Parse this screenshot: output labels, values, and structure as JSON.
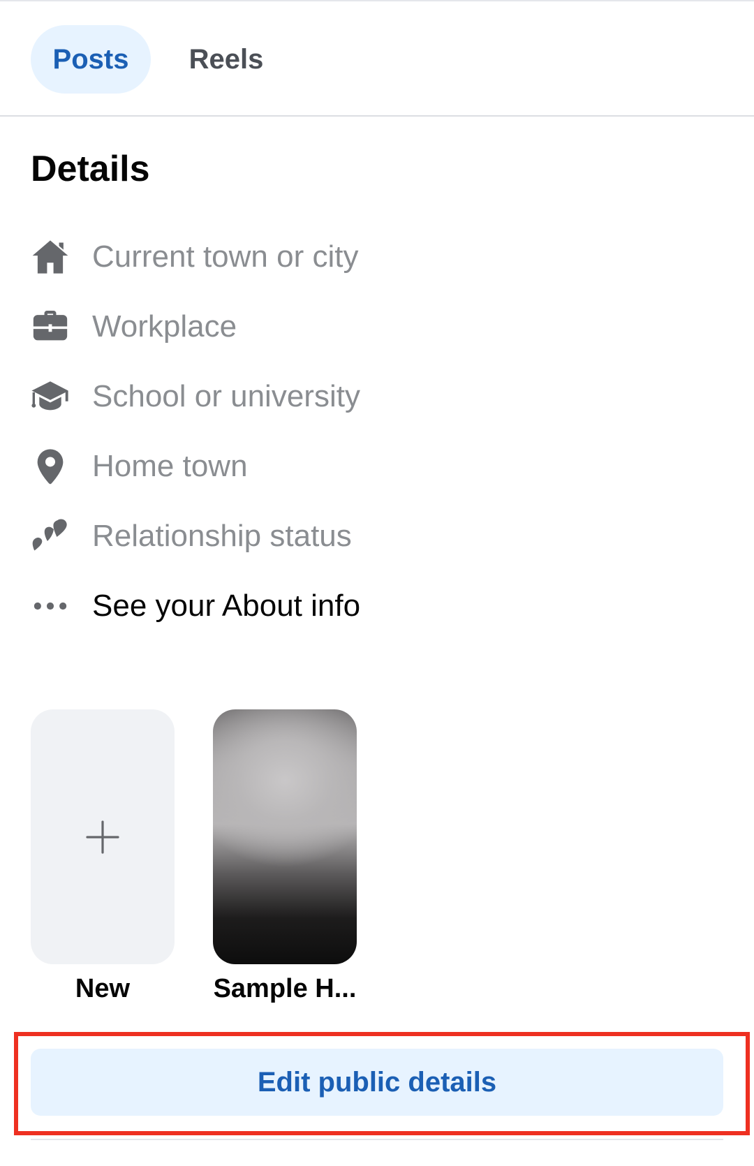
{
  "tabs": [
    {
      "label": "Posts",
      "active": true
    },
    {
      "label": "Reels",
      "active": false
    }
  ],
  "details": {
    "title": "Details",
    "items": [
      {
        "label": "Current town or city",
        "icon": "home-icon"
      },
      {
        "label": "Workplace",
        "icon": "briefcase-icon"
      },
      {
        "label": "School or university",
        "icon": "graduation-cap-icon"
      },
      {
        "label": "Home town",
        "icon": "location-pin-icon"
      },
      {
        "label": "Relationship status",
        "icon": "hearts-icon"
      },
      {
        "label": "See your About info",
        "icon": "more-dots-icon"
      }
    ]
  },
  "featured": {
    "new_label": "New",
    "items": [
      {
        "label": "Sample H..."
      }
    ]
  },
  "edit_button": {
    "label": "Edit public details"
  },
  "colors": {
    "accent": "#1b5fb4",
    "accent_bg": "#e7f3ff",
    "highlight": "#ee3021",
    "muted_text": "#8a8d91"
  }
}
